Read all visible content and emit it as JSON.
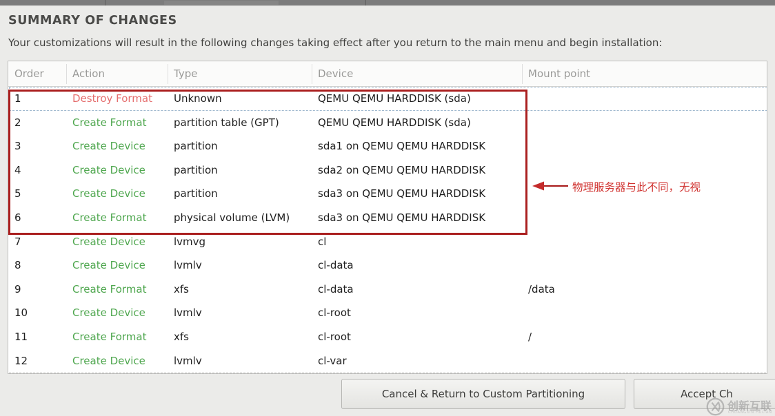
{
  "window": {
    "title": "SUMMARY OF CHANGES",
    "description": "Your customizations will result in the following changes taking effect after you return to the main menu and begin installation:"
  },
  "table": {
    "columns": [
      "Order",
      "Action",
      "Type",
      "Device",
      "Mount point"
    ],
    "rows": [
      {
        "order": "1",
        "action": "Destroy Format",
        "action_kind": "destroy",
        "type": "Unknown",
        "device": "QEMU QEMU HARDDISK (sda)",
        "mount": ""
      },
      {
        "order": "2",
        "action": "Create Format",
        "action_kind": "create",
        "type": "partition table (GPT)",
        "device": "QEMU QEMU HARDDISK (sda)",
        "mount": ""
      },
      {
        "order": "3",
        "action": "Create Device",
        "action_kind": "create",
        "type": "partition",
        "device": "sda1 on QEMU QEMU HARDDISK",
        "mount": ""
      },
      {
        "order": "4",
        "action": "Create Device",
        "action_kind": "create",
        "type": "partition",
        "device": "sda2 on QEMU QEMU HARDDISK",
        "mount": ""
      },
      {
        "order": "5",
        "action": "Create Device",
        "action_kind": "create",
        "type": "partition",
        "device": "sda3 on QEMU QEMU HARDDISK",
        "mount": ""
      },
      {
        "order": "6",
        "action": "Create Format",
        "action_kind": "create",
        "type": "physical volume (LVM)",
        "device": "sda3 on QEMU QEMU HARDDISK",
        "mount": ""
      },
      {
        "order": "7",
        "action": "Create Device",
        "action_kind": "create",
        "type": "lvmvg",
        "device": "cl",
        "mount": ""
      },
      {
        "order": "8",
        "action": "Create Device",
        "action_kind": "create",
        "type": "lvmlv",
        "device": "cl-data",
        "mount": ""
      },
      {
        "order": "9",
        "action": "Create Format",
        "action_kind": "create",
        "type": "xfs",
        "device": "cl-data",
        "mount": "/data"
      },
      {
        "order": "10",
        "action": "Create Device",
        "action_kind": "create",
        "type": "lvmlv",
        "device": "cl-root",
        "mount": ""
      },
      {
        "order": "11",
        "action": "Create Format",
        "action_kind": "create",
        "type": "xfs",
        "device": "cl-root",
        "mount": "/"
      },
      {
        "order": "12",
        "action": "Create Device",
        "action_kind": "create",
        "type": "lvmlv",
        "device": "cl-var",
        "mount": ""
      }
    ]
  },
  "annotation": {
    "text": "物理服务器与此不同，无视",
    "color": "#d0322f",
    "box_color": "#aa1f1f",
    "highlighted_rows": "1-6"
  },
  "buttons": {
    "cancel": "Cancel & Return to Custom Partitioning",
    "accept": "Accept Ch"
  },
  "watermark": {
    "cn": "创新互联",
    "pinyin": "CHUANGXIN HULIAN"
  },
  "colors": {
    "destroy": "#e56e6e",
    "create": "#4fa74f",
    "background": "#ebebe9",
    "table_bg": "#ffffff",
    "header_text": "#9a9a98"
  }
}
